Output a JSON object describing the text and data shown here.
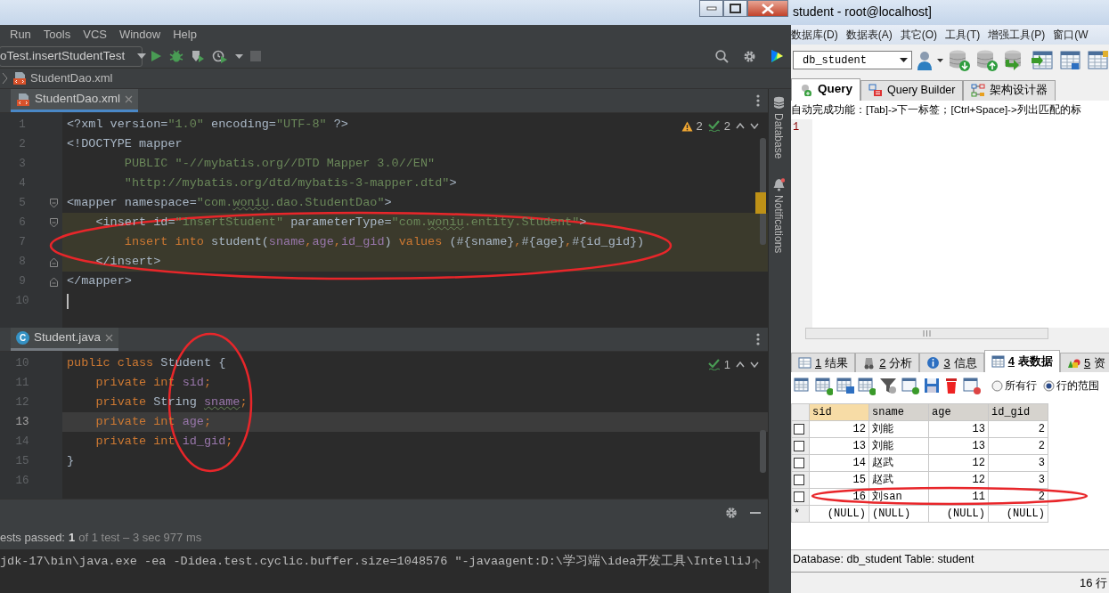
{
  "ide": {
    "menu": [
      "Run",
      "Tools",
      "VCS",
      "Window",
      "Help"
    ],
    "run_config": "oTest.insertStudentTest",
    "breadcrumb": "StudentDao.xml",
    "editors": [
      {
        "tab": {
          "label": "StudentDao.xml",
          "kind": "xml",
          "focused": true
        },
        "inspections": [
          {
            "kind": "warning",
            "count": "2"
          },
          {
            "kind": "ok",
            "count": "2"
          }
        ],
        "lines": [
          {
            "number": "1",
            "kind": "plain",
            "tokens": [
              {
                "kind": "plain",
                "text": "<?xml version="
              },
              {
                "kind": "string",
                "text": "\"1.0\""
              },
              {
                "kind": "plain",
                "text": " encoding="
              },
              {
                "kind": "string",
                "text": "\"UTF-8\""
              },
              {
                "kind": "plain",
                "text": " ?>"
              }
            ]
          },
          {
            "number": "2",
            "kind": "plain",
            "tokens": [
              {
                "kind": "plain",
                "text": "<!DOCTYPE mapper"
              }
            ]
          },
          {
            "number": "3",
            "kind": "plain",
            "tokens": [
              {
                "kind": "string",
                "text": "        PUBLIC "
              },
              {
                "kind": "string",
                "text": "\"-//mybatis.org//DTD Mapper 3.0//EN\""
              }
            ]
          },
          {
            "number": "4",
            "kind": "plain",
            "tokens": [
              {
                "kind": "string",
                "text": "        \"http://mybatis.org/dtd/mybatis-3-mapper.dtd\""
              },
              {
                "kind": "plain",
                "text": ">"
              }
            ]
          },
          {
            "number": "5",
            "kind": "fold_start",
            "tokens": [
              {
                "kind": "plain",
                "text": "<mapper namespace="
              },
              {
                "kind": "string",
                "text": "\"com."
              },
              {
                "kind": "string",
                "text": "woniu",
                "squiggle": true
              },
              {
                "kind": "string",
                "text": ".dao.StudentDao\""
              },
              {
                "kind": "plain",
                "text": ">"
              }
            ]
          },
          {
            "number": "6",
            "kind": "fold_start",
            "highlighted": true,
            "tokens": [
              {
                "kind": "plain",
                "text": "    <insert id="
              },
              {
                "kind": "string",
                "text": "\"insertStudent\""
              },
              {
                "kind": "plain",
                "text": " parameterType="
              },
              {
                "kind": "string",
                "text": "\"com."
              },
              {
                "kind": "string",
                "text": "woniu",
                "squiggle": true
              },
              {
                "kind": "string",
                "text": ".entity.Student\""
              },
              {
                "kind": "plain",
                "text": ">"
              }
            ]
          },
          {
            "number": "7",
            "kind": "plain",
            "highlighted": true,
            "tokens": [
              {
                "kind": "keyword",
                "text": "        insert into "
              },
              {
                "kind": "plain",
                "text": "student("
              },
              {
                "kind": "field",
                "text": "sname"
              },
              {
                "kind": "keyword",
                "text": ","
              },
              {
                "kind": "field",
                "text": "age"
              },
              {
                "kind": "keyword",
                "text": ","
              },
              {
                "kind": "field",
                "text": "id_gid"
              },
              {
                "kind": "plain",
                "text": ") "
              },
              {
                "kind": "keyword",
                "text": "values "
              },
              {
                "kind": "plain",
                "text": "(#{sname}"
              },
              {
                "kind": "keyword",
                "text": ","
              },
              {
                "kind": "plain",
                "text": "#{age}"
              },
              {
                "kind": "keyword",
                "text": ","
              },
              {
                "kind": "plain",
                "text": "#{id_gid})"
              }
            ]
          },
          {
            "number": "8",
            "kind": "fold_end",
            "highlighted": true,
            "tokens": [
              {
                "kind": "plain",
                "text": "    </insert>"
              }
            ]
          },
          {
            "number": "9",
            "kind": "fold_end",
            "tokens": [
              {
                "kind": "plain",
                "text": "</mapper>"
              }
            ]
          },
          {
            "number": "10",
            "kind": "plain",
            "caret": true
          }
        ]
      },
      {
        "tab": {
          "label": "Student.java",
          "kind": "java",
          "badge": "C",
          "focused": false
        },
        "inspections": [
          {
            "kind": "ok",
            "count": "1"
          }
        ],
        "lines": [
          {
            "number": "10",
            "kind": "plain",
            "tokens": [
              {
                "kind": "keyword",
                "text": "public class "
              },
              {
                "kind": "plain",
                "text": "Student {"
              }
            ]
          },
          {
            "number": "11",
            "kind": "plain",
            "tokens": [
              {
                "kind": "keyword",
                "text": "    private int "
              },
              {
                "kind": "field",
                "text": "sid"
              },
              {
                "kind": "keyword",
                "text": ";"
              }
            ]
          },
          {
            "number": "12",
            "kind": "plain",
            "tokens": [
              {
                "kind": "keyword",
                "text": "    private "
              },
              {
                "kind": "plain",
                "text": "String "
              },
              {
                "kind": "field",
                "text": "sname",
                "squiggle": true
              },
              {
                "kind": "keyword",
                "text": ";"
              }
            ]
          },
          {
            "number": "13",
            "kind": "plain",
            "current": true,
            "tokens": [
              {
                "kind": "keyword",
                "text": "    private int "
              },
              {
                "kind": "field",
                "text": "age"
              },
              {
                "kind": "keyword",
                "text": ";"
              }
            ]
          },
          {
            "number": "14",
            "kind": "plain",
            "tokens": [
              {
                "kind": "keyword",
                "text": "    private int "
              },
              {
                "kind": "field",
                "text": "id_gid"
              },
              {
                "kind": "keyword",
                "text": ";"
              }
            ]
          },
          {
            "number": "15",
            "kind": "plain",
            "tokens": [
              {
                "kind": "plain",
                "text": "}"
              }
            ]
          },
          {
            "number": "16",
            "kind": "plain"
          }
        ]
      }
    ],
    "side_tools": [
      {
        "kind": "database",
        "label": "Database"
      },
      {
        "kind": "notifications",
        "label": "Notifications"
      }
    ],
    "run_panel": {
      "status": "ests passed:",
      "count": "1",
      "detail": "of 1 test – 3 sec 977 ms",
      "console": "jdk-17\\bin\\java.exe -ea -Didea.test.cyclic.buffer.size=1048576 \"-javaagent:D:\\学习端\\idea开发工具\\IntelliJ"
    }
  },
  "sqlyog": {
    "title": "student - root@localhost]",
    "menu": [
      "数据库(D)",
      "数据表(A)",
      "其它(O)",
      "工具(T)",
      "增强工具(P)",
      "窗口(W"
    ],
    "database": "db_student",
    "query_tabs": [
      {
        "label": "Query",
        "selected": true
      },
      {
        "label": "Query Builder",
        "selected": false
      },
      {
        "label": "架构设计器",
        "selected": false
      }
    ],
    "hint": "自动完成功能：[Tab]->下一标签；[Ctrl+Space]->列出匹配的标",
    "editor_lines": [
      "1"
    ],
    "result_tabs": [
      {
        "key": "1",
        "label": "结果",
        "selected": false
      },
      {
        "key": "2",
        "label": "分析",
        "selected": false
      },
      {
        "key": "3",
        "label": "信息",
        "selected": false
      },
      {
        "key": "4",
        "label": "表数据",
        "selected": true
      },
      {
        "key": "5",
        "label": "资",
        "selected": false
      }
    ],
    "row_scope": [
      {
        "label": "所有行",
        "selected": false
      },
      {
        "label": "行的范围",
        "selected": true
      }
    ],
    "table": {
      "columns": [
        {
          "label": "sid",
          "kind": "number",
          "selected": true
        },
        {
          "label": "sname",
          "kind": "text",
          "selected": false
        },
        {
          "label": "age",
          "kind": "number",
          "selected": false
        },
        {
          "label": "id_gid",
          "kind": "number",
          "selected": false
        }
      ],
      "rows": [
        {
          "kind": "data",
          "checked": false,
          "cells": [
            "12",
            "刘能",
            "13",
            "2"
          ]
        },
        {
          "kind": "data",
          "checked": false,
          "cells": [
            "13",
            "刘能",
            "13",
            "2"
          ]
        },
        {
          "kind": "data",
          "checked": false,
          "cells": [
            "14",
            "赵武",
            "12",
            "3"
          ]
        },
        {
          "kind": "data",
          "checked": false,
          "cells": [
            "15",
            "赵武",
            "12",
            "3"
          ]
        },
        {
          "kind": "data",
          "checked": false,
          "cells": [
            "16",
            "刘san",
            "11",
            "2"
          ]
        },
        {
          "kind": "new",
          "marker": "*",
          "cells": [
            "(NULL)",
            "(NULL)",
            "(NULL)",
            "(NULL)"
          ]
        }
      ]
    },
    "status": "Database: db_student Table: student",
    "row_count": "16 行"
  }
}
